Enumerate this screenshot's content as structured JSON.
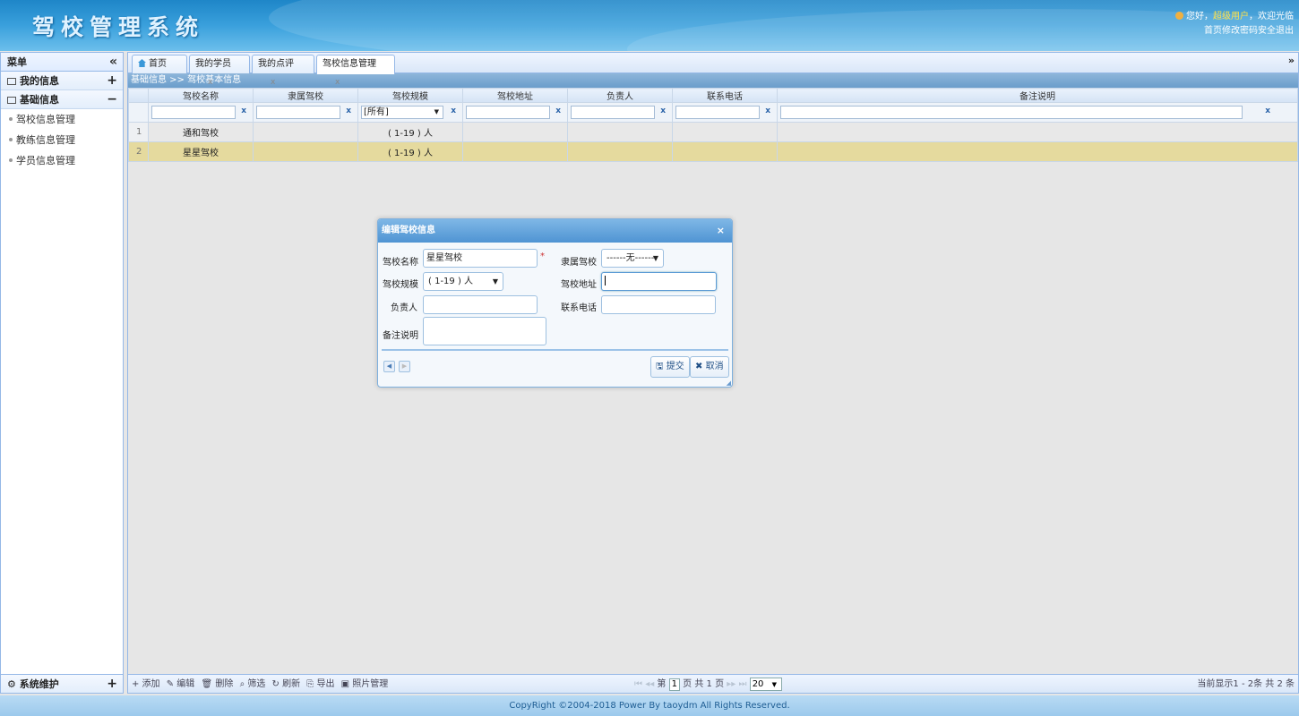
{
  "header": {
    "title": "驾校管理系统",
    "greeting": "您好，",
    "user": "超级用户",
    "welcome": "，欢迎光临",
    "links": "首页修改密码安全退出"
  },
  "sidebar": {
    "title": "菜单",
    "collapse": "«",
    "groups": [
      {
        "label": "我的信息",
        "toggle": "+"
      },
      {
        "label": "基础信息",
        "toggle": "−"
      }
    ],
    "items": [
      "驾校信息管理",
      "教练信息管理",
      "学员信息管理"
    ],
    "bottom": {
      "label": "系统维护",
      "toggle": "+"
    }
  },
  "tabs": [
    {
      "label": "首页"
    },
    {
      "label": "我的学员",
      "close": "x"
    },
    {
      "label": "我的点评",
      "close": "x"
    },
    {
      "label": "驾校信息管理",
      "close": "x"
    }
  ],
  "tab_more": "»",
  "breadcrumb": "基础信息 >> 驾校基本信息",
  "grid": {
    "columns": [
      "驾校名称",
      "隶属驾校",
      "驾校规模",
      "驾校地址",
      "负责人",
      "联系电话",
      "备注说明"
    ],
    "filter_select": "[所有]",
    "filter_clear": "x",
    "rows": [
      {
        "num": "1",
        "name": "通和驾校",
        "parent": "",
        "scale": "( 1-19 ) 人",
        "address": "",
        "owner": "",
        "phone": "",
        "remark": ""
      },
      {
        "num": "2",
        "name": "星星驾校",
        "parent": "",
        "scale": "( 1-19 ) 人",
        "address": "",
        "owner": "",
        "phone": "",
        "remark": ""
      }
    ]
  },
  "toolbar": {
    "add": "+ 添加",
    "edit": "✎ 编辑",
    "del": "🗑 删除",
    "filter": "⌕ 筛选",
    "refresh": "↻ 刷新",
    "export": "⎘ 导出",
    "photo": "▣ 照片管理"
  },
  "pager": {
    "first": "⏮",
    "prev": "◂◂",
    "page_prefix": "第",
    "page": "1",
    "page_suffix": "页 共 1 页",
    "next": "▸▸",
    "last": "⏭",
    "size": "20",
    "info": "当前显示1 - 2条   共 2 条"
  },
  "footer": "CopyRight ©2004-2018 Power By taoydm   All Rights Reserved.",
  "dialog": {
    "title": "编辑驾校信息",
    "close": "×",
    "labels": {
      "name": "驾校名称",
      "parent": "隶属驾校",
      "scale": "驾校规模",
      "address": "驾校地址",
      "owner": "负责人",
      "phone": "联系电话",
      "remark": "备注说明"
    },
    "required": "*",
    "values": {
      "name": "星星驾校",
      "parent": "------无------",
      "scale": "( 1-19 ) 人"
    },
    "submit": "提交",
    "cancel": "取消"
  }
}
